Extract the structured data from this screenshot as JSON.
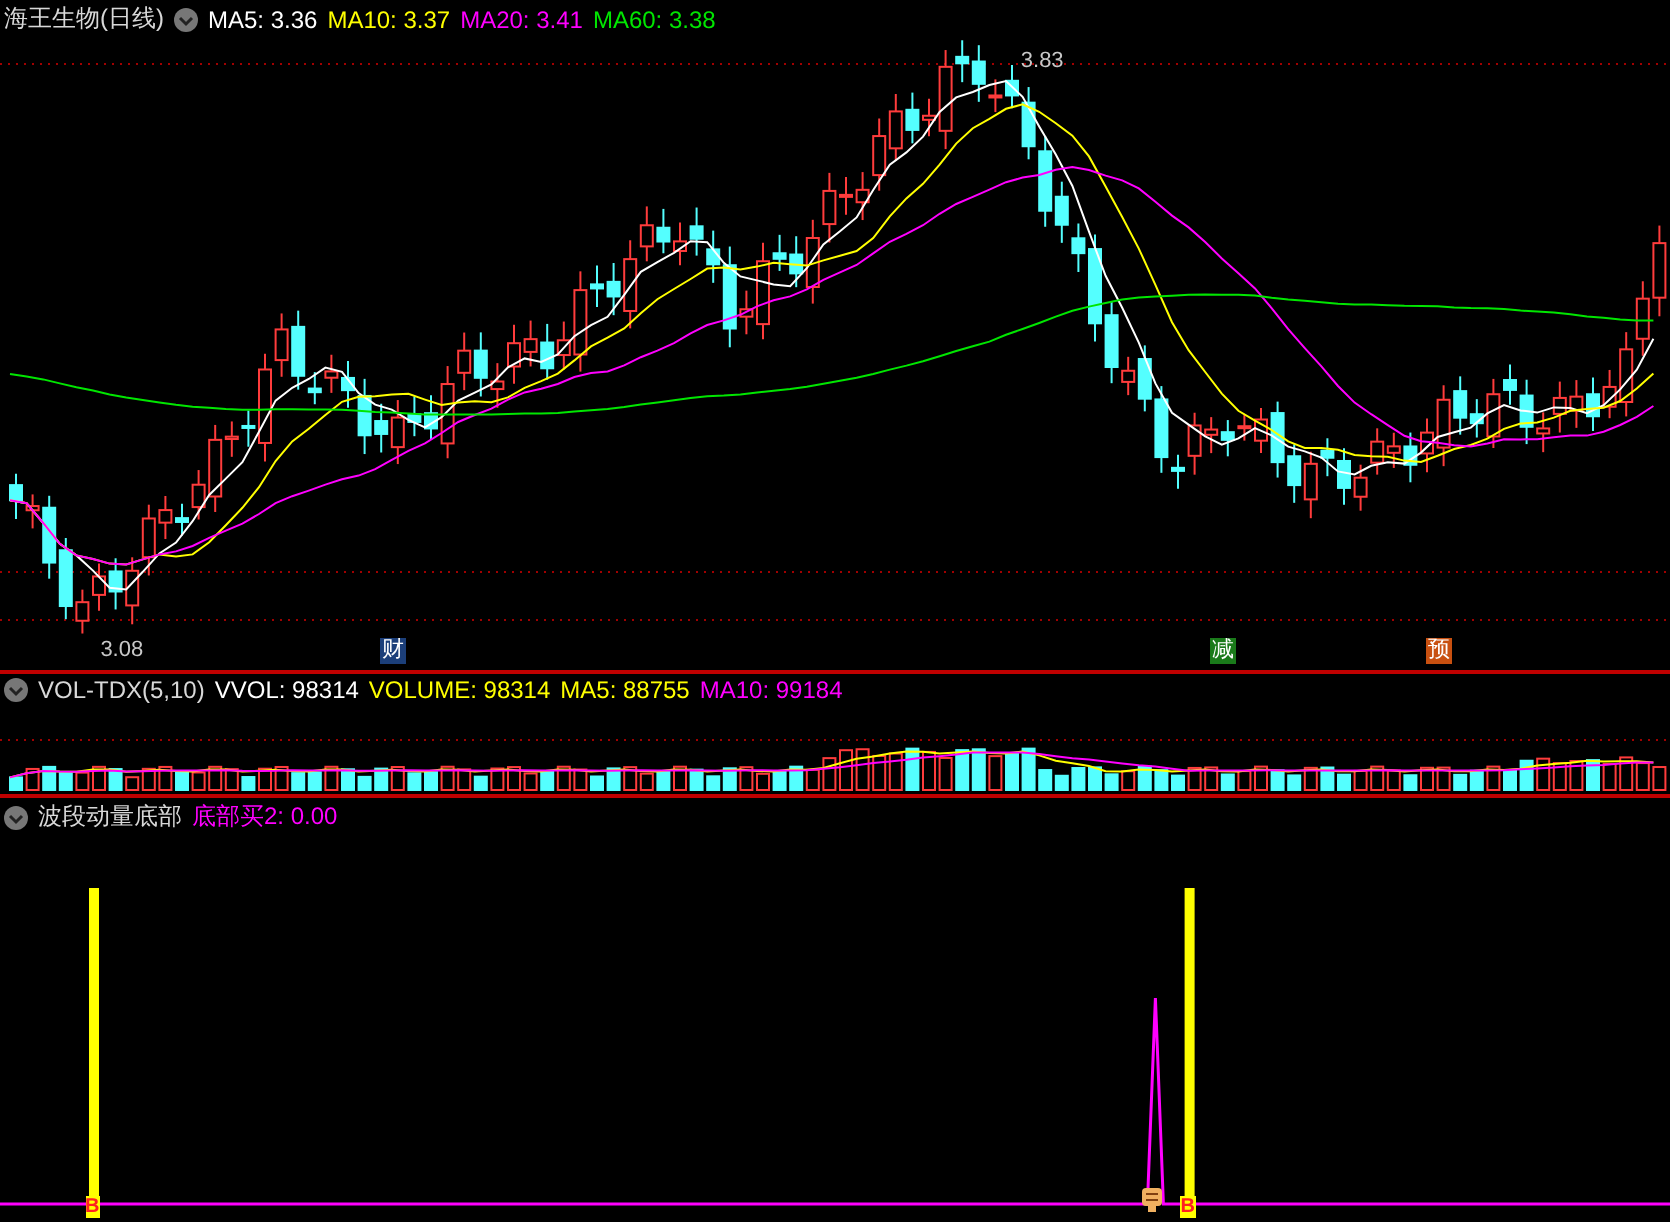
{
  "main_panel": {
    "title": "海王生物(日线)",
    "indicators": [
      {
        "label": "MA5: 3.36",
        "color": "#ffffff"
      },
      {
        "label": "MA10: 3.37",
        "color": "#ffff00"
      },
      {
        "label": "MA20: 3.41",
        "color": "#ff00ff"
      },
      {
        "label": "MA60: 3.38",
        "color": "#00e600"
      }
    ],
    "high_label": "3.83",
    "low_label": "3.08",
    "event_badges": [
      {
        "label": "财",
        "color": "#1c3f7a"
      },
      {
        "label": "减",
        "color": "#1a7a1a"
      },
      {
        "label": "预",
        "color": "#c85010"
      }
    ]
  },
  "volume_panel": {
    "title": "VOL-TDX(5,10)",
    "indicators": [
      {
        "label": "VVOL: 98314",
        "color": "#ffffff"
      },
      {
        "label": "VOLUME: 98314",
        "color": "#ffff00"
      },
      {
        "label": "MA5: 88755",
        "color": "#ffff00"
      },
      {
        "label": "MA10: 99184",
        "color": "#ff00ff"
      }
    ]
  },
  "signal_panel": {
    "title": "波段动量底部",
    "indicators": [
      {
        "label": "底部买2: 0.00",
        "color": "#ff00ff"
      }
    ],
    "buy_markers": [
      "B",
      "B"
    ]
  }
}
